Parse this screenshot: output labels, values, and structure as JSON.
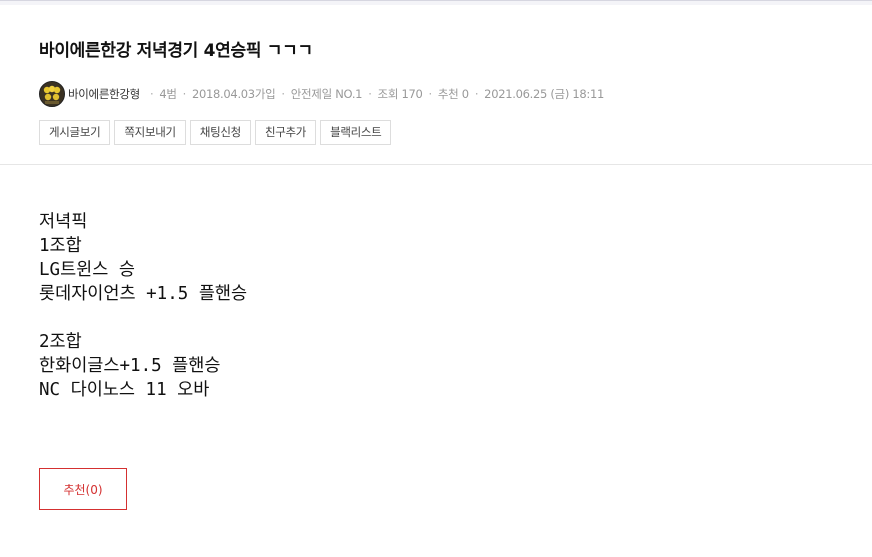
{
  "post": {
    "title": "바이에른한강 저녁경기 4연승픽 ㄱㄱㄱ",
    "author": "바이에른한강형",
    "rank": "4범",
    "joined": "2018.04.03가입",
    "badge": "안전제일 NO.1",
    "views": "조회 170",
    "recommends": "추천 0",
    "datetime": "2021.06.25 (금) 18:11"
  },
  "actions": [
    "게시글보기",
    "쪽지보내기",
    "채팅신청",
    "친구추가",
    "블랙리스트"
  ],
  "content_lines": [
    "저녁픽",
    "1조합",
    "LG트윈스 승",
    "롯데자이언츠 +1.5 플핸승",
    "",
    "2조합",
    "한화이글스+1.5 플핸승",
    "NC 다이노스 11 오바"
  ],
  "recommend_button": "추천(0)",
  "colors": {
    "accent": "#d43030",
    "meta": "#999999",
    "border": "#dddddd"
  }
}
